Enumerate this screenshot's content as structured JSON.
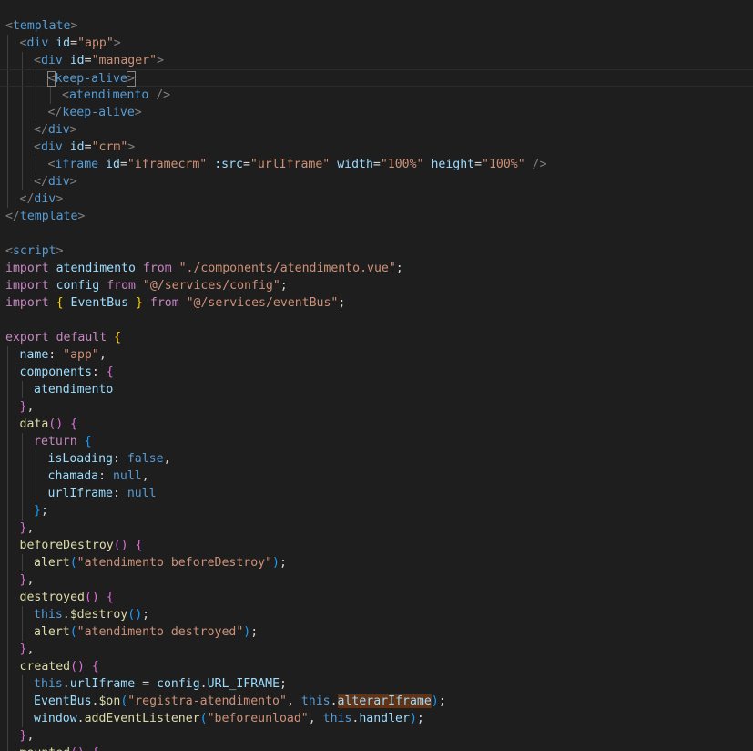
{
  "colors": {
    "background": "#1e1e1e",
    "tag": "#569cd6",
    "attribute": "#9cdcfe",
    "string": "#ce9178",
    "keyword": "#c586c0",
    "function": "#dcdcaa",
    "bracket_gold": "#ffd700",
    "bracket_magenta": "#da70d6",
    "bracket_blue": "#179fff",
    "selection_highlight": "#613214"
  },
  "editor": {
    "lines": [
      {
        "indent": 0,
        "tokens": [
          [
            "<",
            "punct"
          ],
          [
            "template",
            "tag"
          ],
          [
            ">",
            "punct"
          ]
        ]
      },
      {
        "indent": 1,
        "tokens": [
          [
            "<",
            "punct"
          ],
          [
            "div",
            "tag"
          ],
          [
            " ",
            "plain"
          ],
          [
            "id",
            "attr"
          ],
          [
            "=",
            "plain"
          ],
          [
            "\"app\"",
            "str"
          ],
          [
            ">",
            "punct"
          ]
        ]
      },
      {
        "indent": 2,
        "tokens": [
          [
            "<",
            "punct"
          ],
          [
            "div",
            "tag"
          ],
          [
            " ",
            "plain"
          ],
          [
            "id",
            "attr"
          ],
          [
            "=",
            "plain"
          ],
          [
            "\"manager\"",
            "str"
          ],
          [
            ">",
            "punct"
          ]
        ]
      },
      {
        "indent": 3,
        "active": true,
        "tokens": [
          [
            "<",
            "punct match"
          ],
          [
            "keep-alive",
            "tag"
          ],
          [
            ">",
            "punct match"
          ]
        ]
      },
      {
        "indent": 4,
        "tokens": [
          [
            "<",
            "punct"
          ],
          [
            "atendimento",
            "tag"
          ],
          [
            " />",
            "punct"
          ]
        ]
      },
      {
        "indent": 3,
        "tokens": [
          [
            "</",
            "punct"
          ],
          [
            "keep-alive",
            "tag"
          ],
          [
            ">",
            "punct"
          ]
        ]
      },
      {
        "indent": 2,
        "tokens": [
          [
            "</",
            "punct"
          ],
          [
            "div",
            "tag"
          ],
          [
            ">",
            "punct"
          ]
        ]
      },
      {
        "indent": 2,
        "tokens": [
          [
            "<",
            "punct"
          ],
          [
            "div",
            "tag"
          ],
          [
            " ",
            "plain"
          ],
          [
            "id",
            "attr"
          ],
          [
            "=",
            "plain"
          ],
          [
            "\"crm\"",
            "str"
          ],
          [
            ">",
            "punct"
          ]
        ]
      },
      {
        "indent": 3,
        "tokens": [
          [
            "<",
            "punct"
          ],
          [
            "iframe",
            "tag"
          ],
          [
            " ",
            "plain"
          ],
          [
            "id",
            "attr"
          ],
          [
            "=",
            "plain"
          ],
          [
            "\"iframecrm\"",
            "str"
          ],
          [
            " ",
            "plain"
          ],
          [
            ":src",
            "attr"
          ],
          [
            "=",
            "plain"
          ],
          [
            "\"urlIframe\"",
            "str"
          ],
          [
            " ",
            "plain"
          ],
          [
            "width",
            "attr"
          ],
          [
            "=",
            "plain"
          ],
          [
            "\"100%\"",
            "str"
          ],
          [
            " ",
            "plain"
          ],
          [
            "height",
            "attr"
          ],
          [
            "=",
            "plain"
          ],
          [
            "\"100%\"",
            "str"
          ],
          [
            " />",
            "punct"
          ]
        ]
      },
      {
        "indent": 2,
        "tokens": [
          [
            "</",
            "punct"
          ],
          [
            "div",
            "tag"
          ],
          [
            ">",
            "punct"
          ]
        ]
      },
      {
        "indent": 1,
        "tokens": [
          [
            "</",
            "punct"
          ],
          [
            "div",
            "tag"
          ],
          [
            ">",
            "punct"
          ]
        ]
      },
      {
        "indent": 0,
        "tokens": [
          [
            "</",
            "punct"
          ],
          [
            "template",
            "tag"
          ],
          [
            ">",
            "punct"
          ]
        ]
      },
      {
        "indent": 0,
        "tokens": []
      },
      {
        "indent": 0,
        "tokens": [
          [
            "<",
            "punct"
          ],
          [
            "script",
            "tag"
          ],
          [
            ">",
            "punct"
          ]
        ]
      },
      {
        "indent": 0,
        "tokens": [
          [
            "import",
            "kw"
          ],
          [
            " ",
            "plain"
          ],
          [
            "atendimento",
            "var"
          ],
          [
            " ",
            "plain"
          ],
          [
            "from",
            "kw"
          ],
          [
            " ",
            "plain"
          ],
          [
            "\"./components/atendimento.vue\"",
            "str"
          ],
          [
            ";",
            "plain"
          ]
        ]
      },
      {
        "indent": 0,
        "tokens": [
          [
            "import",
            "kw"
          ],
          [
            " ",
            "plain"
          ],
          [
            "config",
            "var"
          ],
          [
            " ",
            "plain"
          ],
          [
            "from",
            "kw"
          ],
          [
            " ",
            "plain"
          ],
          [
            "\"@/services/config\"",
            "str"
          ],
          [
            ";",
            "plain"
          ]
        ]
      },
      {
        "indent": 0,
        "tokens": [
          [
            "import",
            "kw"
          ],
          [
            " ",
            "plain"
          ],
          [
            "{",
            "brace"
          ],
          [
            " ",
            "plain"
          ],
          [
            "EventBus",
            "var"
          ],
          [
            " ",
            "plain"
          ],
          [
            "}",
            "brace"
          ],
          [
            " ",
            "plain"
          ],
          [
            "from",
            "kw"
          ],
          [
            " ",
            "plain"
          ],
          [
            "\"@/services/eventBus\"",
            "str"
          ],
          [
            ";",
            "plain"
          ]
        ]
      },
      {
        "indent": 0,
        "tokens": []
      },
      {
        "indent": 0,
        "tokens": [
          [
            "export",
            "kw"
          ],
          [
            " ",
            "plain"
          ],
          [
            "default",
            "kw"
          ],
          [
            " ",
            "plain"
          ],
          [
            "{",
            "brace"
          ]
        ]
      },
      {
        "indent": 1,
        "tokens": [
          [
            "name",
            "var"
          ],
          [
            ": ",
            "plain"
          ],
          [
            "\"app\"",
            "str"
          ],
          [
            ",",
            "plain"
          ]
        ]
      },
      {
        "indent": 1,
        "tokens": [
          [
            "components",
            "var"
          ],
          [
            ": ",
            "plain"
          ],
          [
            "{",
            "brace2"
          ]
        ]
      },
      {
        "indent": 2,
        "tokens": [
          [
            "atendimento",
            "var"
          ]
        ]
      },
      {
        "indent": 1,
        "tokens": [
          [
            "}",
            "brace2"
          ],
          [
            ",",
            "plain"
          ]
        ]
      },
      {
        "indent": 1,
        "tokens": [
          [
            "data",
            "fn"
          ],
          [
            "()",
            "brace2"
          ],
          [
            " ",
            "plain"
          ],
          [
            "{",
            "brace2"
          ]
        ]
      },
      {
        "indent": 2,
        "tokens": [
          [
            "return",
            "kw"
          ],
          [
            " ",
            "plain"
          ],
          [
            "{",
            "brace3"
          ]
        ]
      },
      {
        "indent": 3,
        "tokens": [
          [
            "isLoading",
            "var"
          ],
          [
            ": ",
            "plain"
          ],
          [
            "false",
            "kw2"
          ],
          [
            ",",
            "plain"
          ]
        ]
      },
      {
        "indent": 3,
        "tokens": [
          [
            "chamada",
            "var"
          ],
          [
            ": ",
            "plain"
          ],
          [
            "null",
            "kw2"
          ],
          [
            ",",
            "plain"
          ]
        ]
      },
      {
        "indent": 3,
        "tokens": [
          [
            "urlIframe",
            "var"
          ],
          [
            ": ",
            "plain"
          ],
          [
            "null",
            "kw2"
          ]
        ]
      },
      {
        "indent": 2,
        "tokens": [
          [
            "}",
            "brace3"
          ],
          [
            ";",
            "plain"
          ]
        ]
      },
      {
        "indent": 1,
        "tokens": [
          [
            "}",
            "brace2"
          ],
          [
            ",",
            "plain"
          ]
        ]
      },
      {
        "indent": 1,
        "tokens": [
          [
            "beforeDestroy",
            "fn"
          ],
          [
            "()",
            "brace2"
          ],
          [
            " ",
            "plain"
          ],
          [
            "{",
            "brace2"
          ]
        ]
      },
      {
        "indent": 2,
        "tokens": [
          [
            "alert",
            "fn"
          ],
          [
            "(",
            "brace3"
          ],
          [
            "\"atendimento beforeDestroy\"",
            "str"
          ],
          [
            ")",
            "brace3"
          ],
          [
            ";",
            "plain"
          ]
        ]
      },
      {
        "indent": 1,
        "tokens": [
          [
            "}",
            "brace2"
          ],
          [
            ",",
            "plain"
          ]
        ]
      },
      {
        "indent": 1,
        "tokens": [
          [
            "destroyed",
            "fn"
          ],
          [
            "()",
            "brace2"
          ],
          [
            " ",
            "plain"
          ],
          [
            "{",
            "brace2"
          ]
        ]
      },
      {
        "indent": 2,
        "tokens": [
          [
            "this",
            "kw2"
          ],
          [
            ".",
            "plain"
          ],
          [
            "$destroy",
            "fn"
          ],
          [
            "()",
            "brace3"
          ],
          [
            ";",
            "plain"
          ]
        ]
      },
      {
        "indent": 2,
        "tokens": [
          [
            "alert",
            "fn"
          ],
          [
            "(",
            "brace3"
          ],
          [
            "\"atendimento destroyed\"",
            "str"
          ],
          [
            ")",
            "brace3"
          ],
          [
            ";",
            "plain"
          ]
        ]
      },
      {
        "indent": 1,
        "tokens": [
          [
            "}",
            "brace2"
          ],
          [
            ",",
            "plain"
          ]
        ]
      },
      {
        "indent": 1,
        "tokens": [
          [
            "created",
            "fn"
          ],
          [
            "()",
            "brace2"
          ],
          [
            " ",
            "plain"
          ],
          [
            "{",
            "brace2"
          ]
        ]
      },
      {
        "indent": 2,
        "tokens": [
          [
            "this",
            "kw2"
          ],
          [
            ".",
            "plain"
          ],
          [
            "urlIframe",
            "var"
          ],
          [
            " = ",
            "plain"
          ],
          [
            "config",
            "var"
          ],
          [
            ".",
            "plain"
          ],
          [
            "URL_IFRAME",
            "var"
          ],
          [
            ";",
            "plain"
          ]
        ]
      },
      {
        "indent": 2,
        "tokens": [
          [
            "EventBus",
            "var"
          ],
          [
            ".",
            "plain"
          ],
          [
            "$on",
            "fn"
          ],
          [
            "(",
            "brace3"
          ],
          [
            "\"registra-atendimento\"",
            "str"
          ],
          [
            ", ",
            "plain"
          ],
          [
            "this",
            "kw2"
          ],
          [
            ".",
            "plain"
          ],
          [
            "alterarIframe",
            "var hl"
          ],
          [
            ")",
            "brace3"
          ],
          [
            ";",
            "plain"
          ]
        ]
      },
      {
        "indent": 2,
        "tokens": [
          [
            "window",
            "var"
          ],
          [
            ".",
            "plain"
          ],
          [
            "addEventListener",
            "fn"
          ],
          [
            "(",
            "brace3"
          ],
          [
            "\"beforeunload\"",
            "str"
          ],
          [
            ", ",
            "plain"
          ],
          [
            "this",
            "kw2"
          ],
          [
            ".",
            "plain"
          ],
          [
            "handler",
            "var"
          ],
          [
            ")",
            "brace3"
          ],
          [
            ";",
            "plain"
          ]
        ]
      },
      {
        "indent": 1,
        "tokens": [
          [
            "}",
            "brace2"
          ],
          [
            ",",
            "plain"
          ]
        ]
      },
      {
        "indent": 1,
        "tokens": [
          [
            "mounted",
            "fn"
          ],
          [
            "()",
            "brace2"
          ],
          [
            " ",
            "plain"
          ],
          [
            "{",
            "brace2"
          ]
        ]
      }
    ]
  }
}
